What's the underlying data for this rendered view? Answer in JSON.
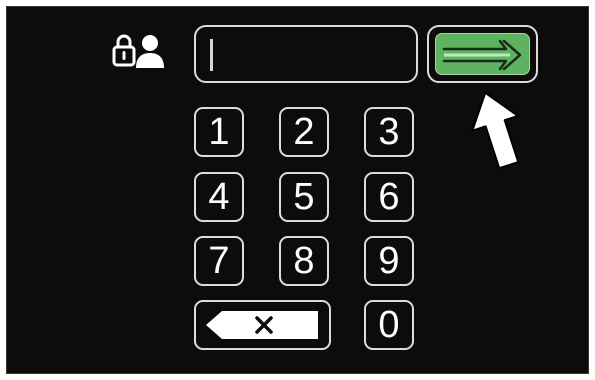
{
  "pin_field": {
    "value": ""
  },
  "keypad": {
    "keys": [
      "1",
      "2",
      "3",
      "4",
      "5",
      "6",
      "7",
      "8",
      "9",
      "0"
    ]
  },
  "icons": {
    "lock": "lock-icon",
    "user": "user-icon",
    "enter": "arrow-right-icon",
    "backspace": "backspace-icon",
    "pointer": "up-arrow-pointer-icon"
  },
  "colors": {
    "screen_background": "#0d0c0b",
    "key_border": "#dcdcdc",
    "enter_fill": "#5fb25f",
    "pointer_arrow": "#ffffff"
  }
}
